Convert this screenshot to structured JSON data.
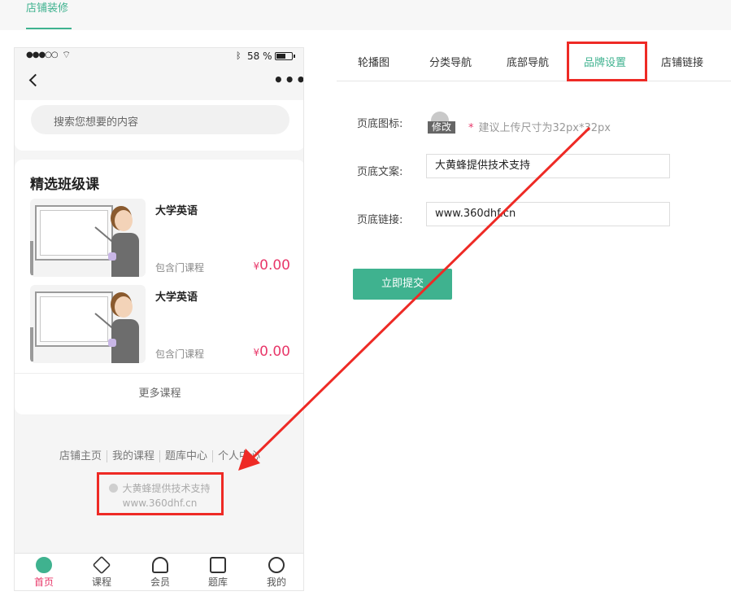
{
  "top_tab": {
    "label": "店铺装修"
  },
  "phone": {
    "status": {
      "signal": "●●●○○",
      "battery": "58 %"
    },
    "search": {
      "placeholder": "搜索您想要的内容"
    },
    "section_title": "精选班级课",
    "courses": [
      {
        "name": "大学英语",
        "desc": "包含门课程",
        "currency": "¥",
        "price": "0.00"
      },
      {
        "name": "大学英语",
        "desc": "包含门课程",
        "currency": "¥",
        "price": "0.00"
      }
    ],
    "more_courses": "更多课程",
    "footer_links": [
      "店铺主页",
      "我的课程",
      "题库中心",
      "个人中心"
    ],
    "brand": {
      "text": "大黄蜂提供技术支持",
      "url": "www.360dhf.cn"
    },
    "tabbar": [
      {
        "label": "首页",
        "icon": "home-icon",
        "active": true
      },
      {
        "label": "课程",
        "icon": "course-icon",
        "active": false
      },
      {
        "label": "会员",
        "icon": "member-icon",
        "active": false
      },
      {
        "label": "题库",
        "icon": "question-bank-icon",
        "active": false
      },
      {
        "label": "我的",
        "icon": "profile-icon",
        "active": false
      }
    ]
  },
  "settings": {
    "tabs": [
      "轮播图",
      "分类导航",
      "底部导航",
      "品牌设置",
      "店铺链接"
    ],
    "active_tab": "品牌设置",
    "footer_icon_label": "页底图标:",
    "edit_label": "修改",
    "hint_star": "*",
    "hint": "建议上传尺寸为32px*32px",
    "footer_text_label": "页底文案:",
    "footer_text_value": "大黄蜂提供技术支持",
    "footer_link_label": "页底链接:",
    "footer_link_value": "www.360dhf.cn",
    "submit_label": "立即提交"
  },
  "colors": {
    "accent": "#3fb28f",
    "highlight": "#ee2a25",
    "price": "#e8386a"
  }
}
